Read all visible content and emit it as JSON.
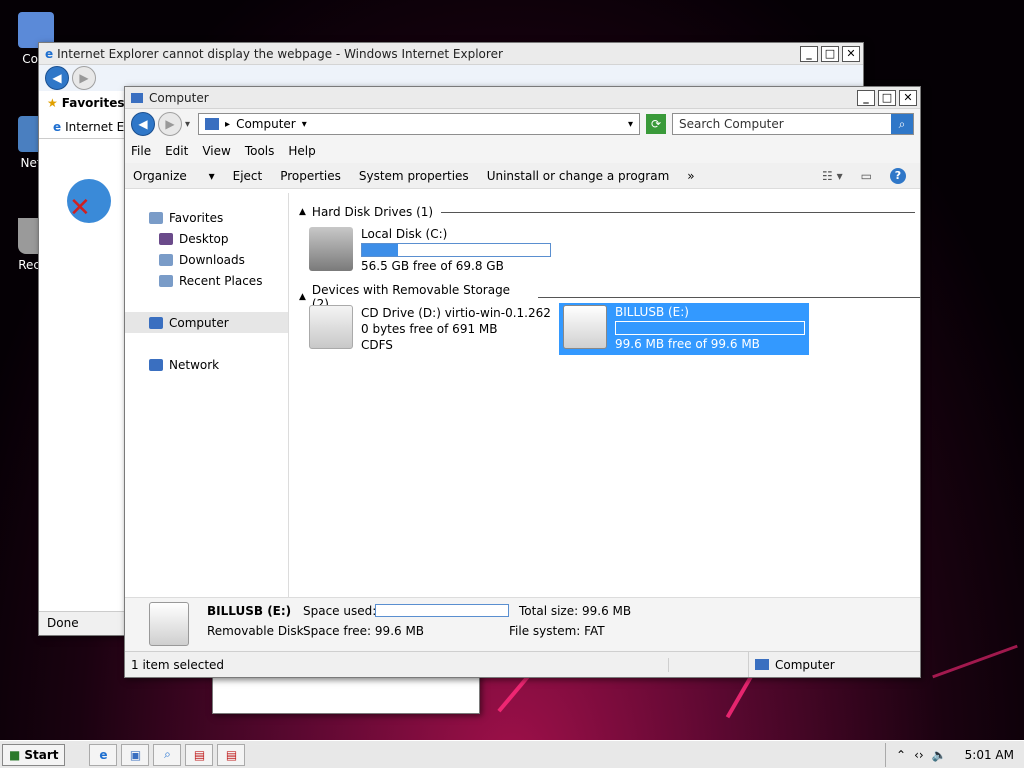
{
  "desktop": {
    "icons": [
      {
        "label": "Com"
      },
      {
        "label": "Netw"
      },
      {
        "label": "Recyc"
      }
    ]
  },
  "ie_window": {
    "title": "Internet Explorer cannot display the webpage - Windows Internet Explorer",
    "favorites_label": "Favorites",
    "tab_label": "Internet E",
    "status": "Done"
  },
  "explorer": {
    "title": "Computer",
    "address": "Computer",
    "search_placeholder": "Search Computer",
    "menu": [
      "File",
      "Edit",
      "View",
      "Tools",
      "Help"
    ],
    "commands": {
      "organize": "Organize",
      "eject": "Eject",
      "properties": "Properties",
      "system_properties": "System properties",
      "uninstall": "Uninstall or change a program",
      "more": "»"
    },
    "nav": {
      "favorites": "Favorites",
      "desktop": "Desktop",
      "downloads": "Downloads",
      "recent_places": "Recent Places",
      "computer": "Computer",
      "network": "Network"
    },
    "groups": {
      "hdd": "Hard Disk Drives (1)",
      "removable": "Devices with Removable Storage (2)"
    },
    "drives": {
      "c": {
        "name": "Local Disk (C:)",
        "free": "56.5 GB free of 69.8 GB",
        "used_fraction": 0.19
      },
      "d": {
        "name": "CD Drive (D:) virtio-win-0.1.262",
        "free": "0 bytes free of 691 MB",
        "fs": "CDFS"
      },
      "e": {
        "name": "BILLUSB (E:)",
        "free": "99.6 MB free of 99.6 MB",
        "used_fraction": 0.0
      }
    },
    "details": {
      "name": "BILLUSB (E:)",
      "type": "Removable Disk",
      "space_used_label": "Space used:",
      "space_free_label": "Space free:",
      "space_free_value": "99.6 MB",
      "total_size_label": "Total size:",
      "total_size_value": "99.6 MB",
      "fs_label": "File system:",
      "fs_value": "FAT"
    },
    "status": {
      "selection": "1 item selected",
      "location": "Computer"
    }
  },
  "taskbar": {
    "start": "Start",
    "time": "5:01 AM"
  }
}
